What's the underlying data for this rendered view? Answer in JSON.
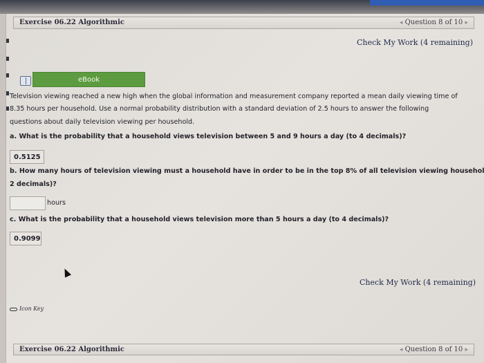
{
  "header": {
    "title": "Exercise 06.22 Algorithmic",
    "question_nav": "Question 8 of 10",
    "prev_glyph": "◂",
    "next_glyph": "▸"
  },
  "check_work": {
    "label": "Check My Work",
    "remaining": "(4 remaining)"
  },
  "ebook": {
    "label": "eBook"
  },
  "problem": {
    "intro_lines": [
      "Television viewing reached a new high when the global information and measurement company reported a mean daily viewing time of",
      "8.35 hours per household. Use a normal probability distribution with a standard deviation of 2.5 hours to answer the following",
      "questions about daily television viewing per household."
    ],
    "part_a": {
      "prefix": "a.",
      "text": "What is the probability that a household views television between 5 and 9 hours a day (to 4 decimals)?",
      "answer": "0.5125"
    },
    "part_b": {
      "prefix": "b.",
      "line1": "How many hours of television viewing must a household have in order to be in the top 8% of all television viewing households (to",
      "line2": "2 decimals)?",
      "input_value": "",
      "unit": "hours"
    },
    "part_c": {
      "prefix": "c.",
      "text": "What is the probability that a household views television more than 5 hours a day (to 4 decimals)?",
      "answer": "0.9099"
    }
  },
  "icon_key": {
    "label": "Icon Key"
  },
  "footer": {
    "title": "Exercise 06.22 Algorithmic",
    "question_nav": "Question 8 of 10"
  }
}
